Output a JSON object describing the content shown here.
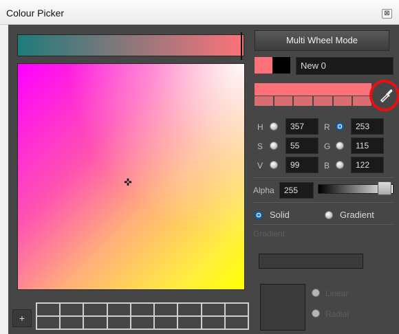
{
  "window": {
    "title": "Colour Picker",
    "close_glyph": "⊠"
  },
  "colors": {
    "current": "#fd7279",
    "previous": "#000000",
    "shade": "#d86d72",
    "highlight_ring": "#e81010"
  },
  "mode_button": {
    "label": "Multi Wheel Mode"
  },
  "colour_name": {
    "value": "New 0"
  },
  "hsv": {
    "h_label": "H",
    "h_value": "357",
    "s_label": "S",
    "s_value": "55",
    "v_label": "V",
    "v_value": "99"
  },
  "rgb": {
    "r_label": "R",
    "r_value": "253",
    "g_label": "G",
    "g_value": "115",
    "b_label": "B",
    "b_value": "122"
  },
  "alpha": {
    "label": "Alpha",
    "value": "255"
  },
  "fill_type": {
    "solid_label": "Solid",
    "gradient_label": "Gradient",
    "selected": "Solid"
  },
  "gradient": {
    "section_label": "Gradient",
    "linear_label": "Linear",
    "radial_label": "Radial"
  },
  "swatches": {
    "add_label": "+",
    "cells": 18
  },
  "icons": {
    "eyedropper": "eyedropper-icon",
    "crosshair": "crosshair-icon"
  }
}
